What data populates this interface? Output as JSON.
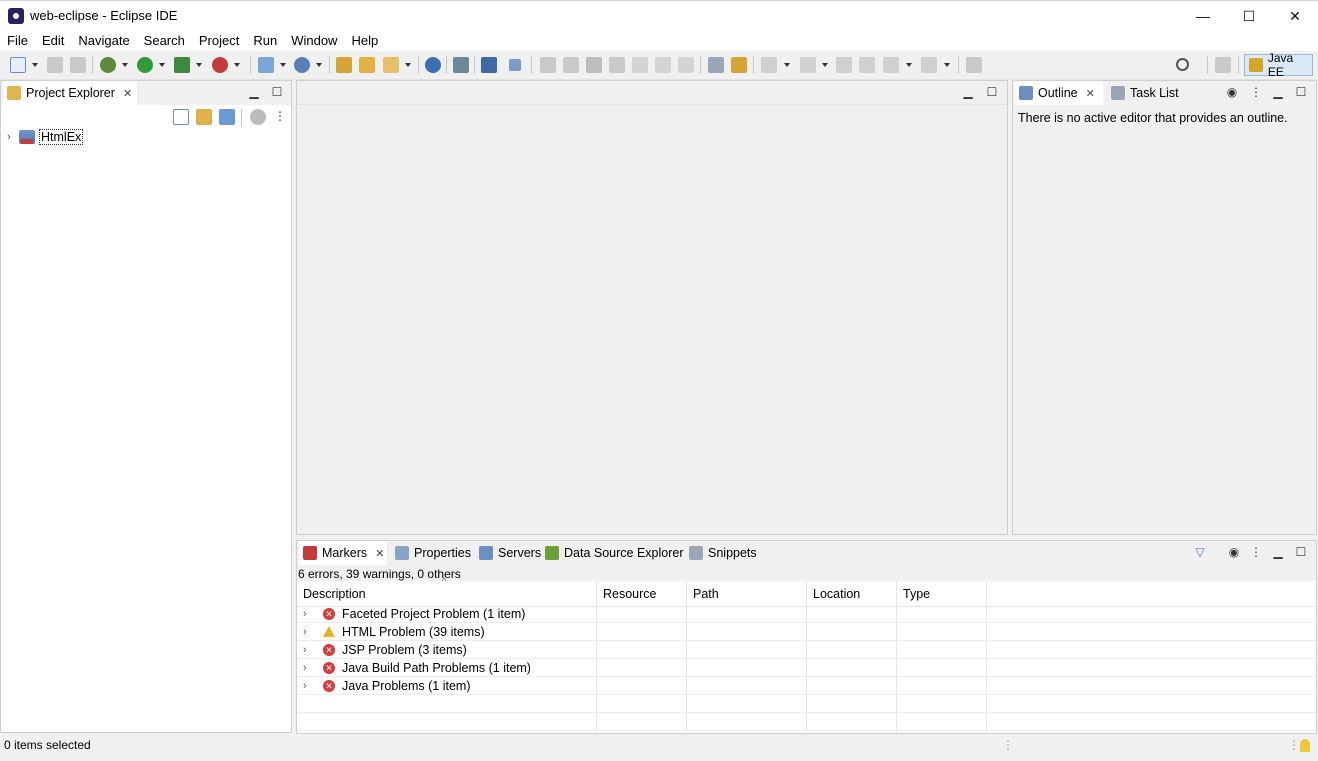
{
  "window": {
    "title": "web-eclipse - Eclipse IDE",
    "controls": {
      "minimize": "—",
      "maximize": "☐",
      "close": "✕"
    }
  },
  "menu": [
    "File",
    "Edit",
    "Navigate",
    "Search",
    "Project",
    "Run",
    "Window",
    "Help"
  ],
  "toolbar": {
    "perspective_label": "Java EE",
    "search_icon": "search-icon"
  },
  "project_explorer": {
    "tab_label": "Project Explorer",
    "projects": [
      "HtmlEx"
    ]
  },
  "outline": {
    "tab_label": "Outline",
    "message": "There is no active editor that provides an outline."
  },
  "task_list": {
    "tab_label": "Task List"
  },
  "bottom_tabs": [
    "Markers",
    "Properties",
    "Servers",
    "Data Source Explorer",
    "Snippets"
  ],
  "markers": {
    "summary": "6 errors, 39 warnings, 0 others",
    "columns": [
      "Description",
      "Resource",
      "Path",
      "Location",
      "Type"
    ],
    "rows": [
      {
        "severity": "error",
        "description": "Faceted Project Problem (1 item)"
      },
      {
        "severity": "warning",
        "description": "HTML Problem (39 items)"
      },
      {
        "severity": "error",
        "description": "JSP Problem (3 items)"
      },
      {
        "severity": "error",
        "description": "Java Build Path Problems (1 item)"
      },
      {
        "severity": "error",
        "description": "Java Problems (1 item)"
      }
    ]
  },
  "status": {
    "text": "0 items selected"
  },
  "colors": {
    "error": "#d63a3a",
    "warning": "#e8b220",
    "perspective_bg": "#dbe8f6"
  }
}
